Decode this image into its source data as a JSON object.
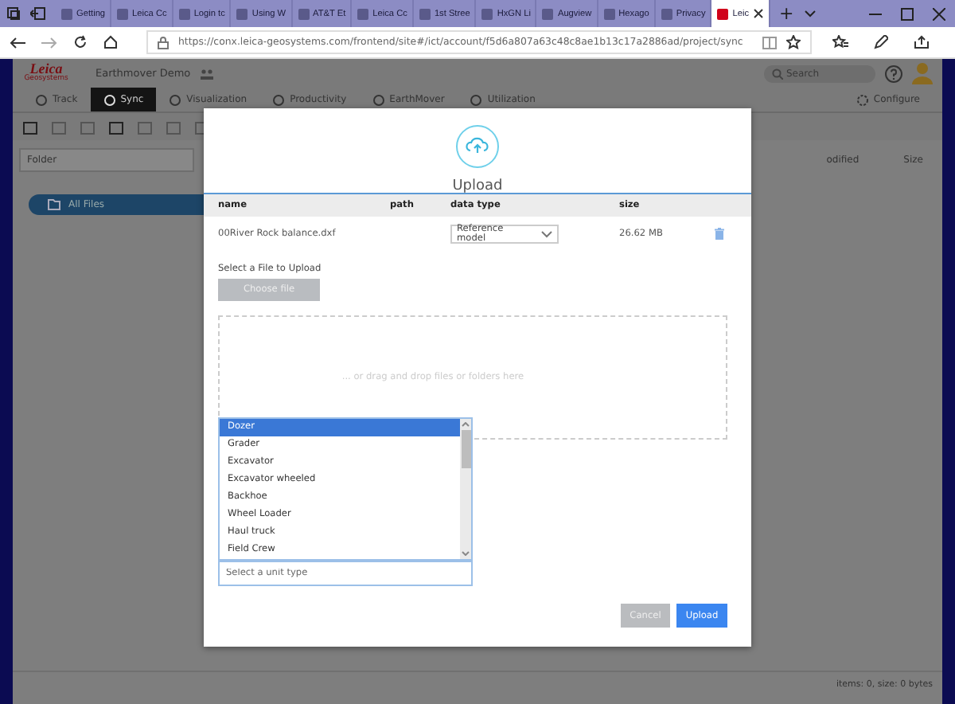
{
  "browser": {
    "tabs": [
      {
        "label": "Getting",
        "selected": false
      },
      {
        "label": "Leica Cc",
        "selected": false
      },
      {
        "label": "Login tc",
        "selected": false
      },
      {
        "label": "Using W",
        "selected": false
      },
      {
        "label": "AT&T Et",
        "selected": false
      },
      {
        "label": "Leica Cc",
        "selected": false
      },
      {
        "label": "1st Stree",
        "selected": false
      },
      {
        "label": "HxGN Li",
        "selected": false
      },
      {
        "label": "Augview",
        "selected": false
      },
      {
        "label": "Hexago",
        "selected": false
      },
      {
        "label": "Privacy",
        "selected": false
      },
      {
        "label": "Leic",
        "selected": true
      }
    ],
    "new_tab": "+",
    "url": "https://conx.leica-geosystems.com/frontend/site#/ict/account/f5d6a807a63c48c8ae1b13c17a2886ad/project/sync"
  },
  "app": {
    "logo": "Leica",
    "logo_sub": "Geosystems",
    "project": "Earthmover Demo",
    "search": {
      "placeholder": "Search"
    },
    "nav": [
      {
        "label": "Track",
        "selected": false
      },
      {
        "label": "Sync",
        "selected": true
      },
      {
        "label": "Visualization",
        "selected": false
      },
      {
        "label": "Productivity",
        "selected": false
      },
      {
        "label": "EarthMover",
        "selected": false
      },
      {
        "label": "Utilization",
        "selected": false
      }
    ],
    "configure": "Configure"
  },
  "files": {
    "folder_column": "Folder",
    "columns": [
      "odified",
      "Size"
    ],
    "folders": [
      {
        "label": "All Files",
        "selected": true
      }
    ],
    "status": "items: 0, size: 0 bytes"
  },
  "dialog": {
    "title": "Upload",
    "columns": [
      "name",
      "path",
      "data type",
      "size"
    ],
    "files": [
      {
        "name": "00River Rock balance.dxf",
        "data_type": "Reference model",
        "size": "26.62 MB"
      }
    ],
    "select_label": "Select a File to Upload",
    "choose_button": "Choose file",
    "drop_hint": "... or drag and drop files or folders here",
    "unit_type": {
      "placeholder": "Select a unit type",
      "options": [
        {
          "label": "Dozer",
          "selected": true
        },
        {
          "label": "Grader",
          "selected": false
        },
        {
          "label": "Excavator",
          "selected": false
        },
        {
          "label": "Excavator wheeled",
          "selected": false
        },
        {
          "label": "Backhoe",
          "selected": false
        },
        {
          "label": "Wheel Loader",
          "selected": false
        },
        {
          "label": "Haul truck",
          "selected": false
        },
        {
          "label": "Field Crew",
          "selected": false
        }
      ]
    },
    "buttons": [
      {
        "label": "Cancel",
        "kind": "secondary"
      },
      {
        "label": "Upload",
        "kind": "primary"
      }
    ]
  }
}
